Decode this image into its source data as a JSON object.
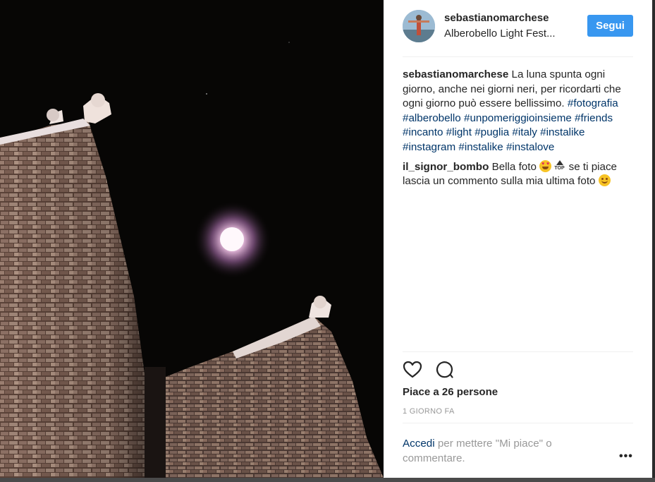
{
  "post": {
    "username": "sebastianomarchese",
    "location": "Alberobello Light Fest...",
    "follow_label": "Segui"
  },
  "caption": {
    "author": "sebastianomarchese",
    "text": "La luna spunta ogni giorno, anche nei giorni neri, per ricordarti che ogni giorno può essere bellissimo.",
    "hashtags": [
      "#fotografia",
      "#alberobello",
      "#unpomeriggioinsieme",
      "#friends",
      "#incanto",
      "#light",
      "#puglia",
      "#italy",
      "#instalike",
      "#instagram",
      "#instalike",
      "#instalove"
    ]
  },
  "comment": {
    "author": "il_signor_bombo",
    "text_before": "Bella foto",
    "emoji_top_label": "TOP",
    "text_after": "se ti piace lascia un commento sulla mia ultima foto",
    "emojis": [
      "heart-eyes-emoji",
      "top-arrow-emoji",
      "smiling-face-emoji"
    ]
  },
  "likes_label": "Piace a 26 persone",
  "time_label": "1 GIORNO FA",
  "login": {
    "link": "Accedi",
    "text": "per mettere \"Mi piace\" o commentare."
  },
  "more_label": "•••",
  "icons": [
    "heart-icon",
    "comment-icon",
    "more-options-icon"
  ],
  "colors": {
    "accent": "#3897f0",
    "hashtag": "#003569",
    "text": "#262626",
    "muted": "#999999"
  }
}
